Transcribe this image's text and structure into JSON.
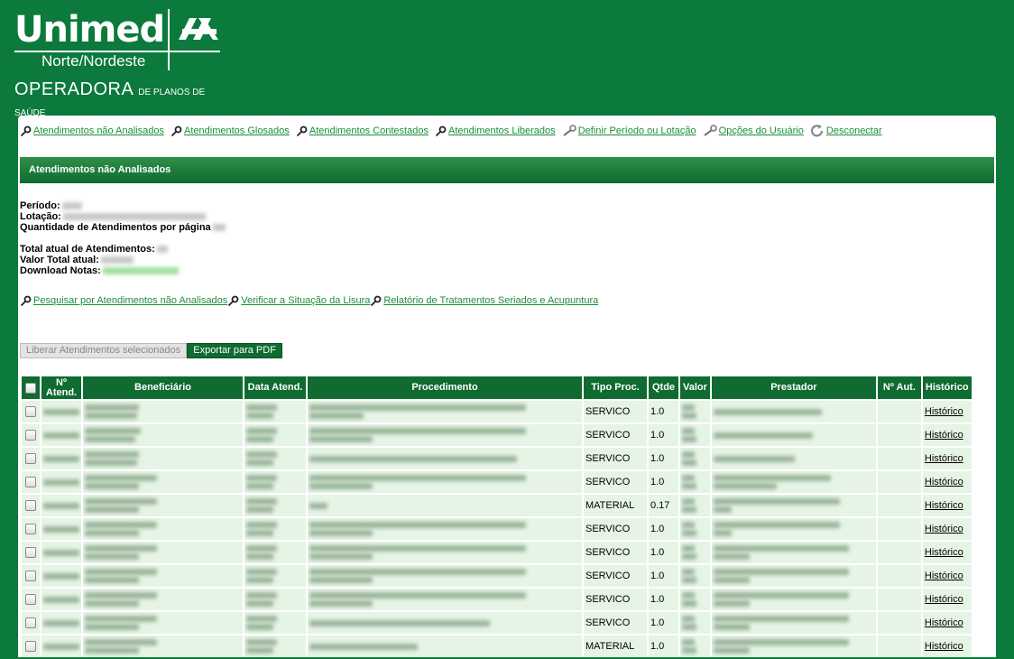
{
  "brand": {
    "name": "Unimed",
    "region": "Norte/Nordeste",
    "tagline_main": "OPERADORA",
    "tagline_small": "DE PLANOS DE SAÚDE"
  },
  "nav": [
    {
      "label": "Atendimentos não Analisados",
      "icon": "key-icon"
    },
    {
      "label": "Atendimentos Glosados",
      "icon": "key-icon"
    },
    {
      "label": "Atendimentos Contestados",
      "icon": "key-icon"
    },
    {
      "label": "Atendimentos Liberados",
      "icon": "key-icon"
    },
    {
      "label": "Definir Período ou Lotação",
      "icon": "wrench-icon"
    },
    {
      "label": "Opções do Usuário",
      "icon": "wrench-icon"
    },
    {
      "label": "Desconectar",
      "icon": "refresh-icon"
    }
  ],
  "section_title": "Atendimentos não Analisados",
  "info": {
    "periodo_label": "Período:",
    "lotacao_label": "Lotação:",
    "qtd_label": "Quantidade de Atendimentos por página",
    "total_label": "Total atual de Atendimentos:",
    "valor_label": "Valor Total atual:",
    "download_label": "Download Notas:"
  },
  "links": [
    {
      "label": "Pesquisar por Atendimentos não Analisados",
      "icon": "key-icon"
    },
    {
      "label": "Verificar a Situação da Lisura",
      "icon": "key-icon"
    },
    {
      "label": "Relatório de Tratamentos Seriados e Acupuntura",
      "icon": "key-icon"
    }
  ],
  "buttons": {
    "release": "Liberar Atendimentos selecionados",
    "export": "Exportar para PDF"
  },
  "table": {
    "headers": {
      "num": "Nº Atend.",
      "beneficiario": "Beneficiário",
      "data": "Data Atend.",
      "procedimento": "Procedimento",
      "tipo": "Tipo Proc.",
      "qtde": "Qtde",
      "valor": "Valor",
      "prestador": "Prestador",
      "aut": "Nº Aut.",
      "historico": "Histórico"
    },
    "rows": [
      {
        "tipo": "SERVICO",
        "qtde": "1.0",
        "historico": "Histórico"
      },
      {
        "tipo": "SERVICO",
        "qtde": "1.0",
        "historico": "Histórico"
      },
      {
        "tipo": "SERVICO",
        "qtde": "1.0",
        "historico": "Histórico"
      },
      {
        "tipo": "SERVICO",
        "qtde": "1.0",
        "historico": "Histórico"
      },
      {
        "tipo": "MATERIAL",
        "qtde": "0.17",
        "historico": "Histórico"
      },
      {
        "tipo": "SERVICO",
        "qtde": "1.0",
        "historico": "Histórico"
      },
      {
        "tipo": "SERVICO",
        "qtde": "1.0",
        "historico": "Histórico"
      },
      {
        "tipo": "SERVICO",
        "qtde": "1.0",
        "historico": "Histórico"
      },
      {
        "tipo": "SERVICO",
        "qtde": "1.0",
        "historico": "Histórico"
      },
      {
        "tipo": "SERVICO",
        "qtde": "1.0",
        "historico": "Histórico"
      },
      {
        "tipo": "MATERIAL",
        "qtde": "1.0",
        "historico": "Histórico"
      }
    ]
  },
  "colors": {
    "brand_green": "#0b7a3c",
    "header_green": "#0f6b30",
    "link_green": "#1b8f3a",
    "row_bg": "#e6f4e6"
  }
}
